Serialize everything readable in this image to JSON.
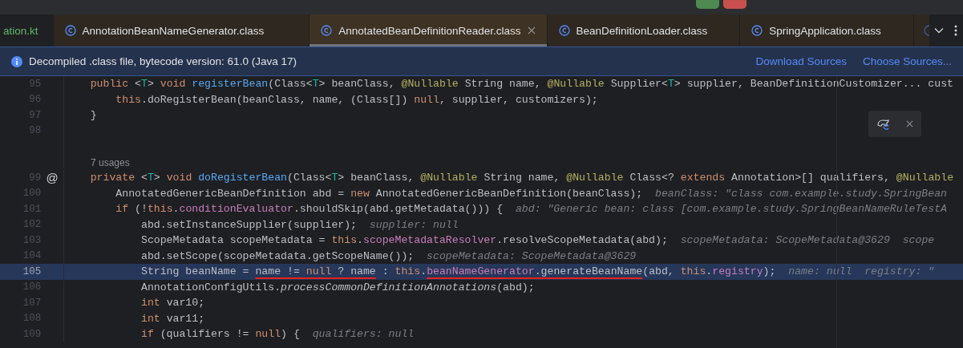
{
  "tabs": [
    {
      "kind": "kotlin",
      "label": "ation.kt",
      "selected": false
    },
    {
      "kind": "class",
      "label": "AnnotationBeanNameGenerator.class",
      "selected": false
    },
    {
      "kind": "class",
      "label": "AnnotatedBeanDefinitionReader.class",
      "selected": true
    },
    {
      "kind": "class",
      "label": "BeanDefinitionLoader.class",
      "selected": false
    },
    {
      "kind": "class",
      "label": "SpringApplication.class",
      "selected": false
    }
  ],
  "banner": {
    "message": "Decompiled .class file, bytecode version: 61.0 (Java 17)",
    "actions": [
      "Download Sources",
      "Choose Sources..."
    ]
  },
  "editor": {
    "lines": [
      {
        "kind": "code",
        "number": "95",
        "current": false,
        "tokens": [
          {
            "kind": "keyword",
            "text": "    public"
          },
          {
            "kind": "plain",
            "text": " <"
          },
          {
            "kind": "typeparam",
            "text": "T"
          },
          {
            "kind": "plain",
            "text": "> "
          },
          {
            "kind": "keyword",
            "text": "void"
          },
          {
            "kind": "method",
            "text": " registerBean"
          },
          {
            "kind": "plain",
            "text": "(Class<"
          },
          {
            "kind": "typeparam",
            "text": "T"
          },
          {
            "kind": "plain",
            "text": "> beanClass, "
          },
          {
            "kind": "annotation",
            "text": "@Nullable"
          },
          {
            "kind": "plain",
            "text": " String name, "
          },
          {
            "kind": "annotation",
            "text": "@Nullable"
          },
          {
            "kind": "plain",
            "text": " Supplier<"
          },
          {
            "kind": "typeparam",
            "text": "T"
          },
          {
            "kind": "plain",
            "text": "> supplier, BeanDefinitionCustomizer... cust"
          }
        ]
      },
      {
        "kind": "code",
        "number": "96",
        "current": false,
        "tokens": [
          {
            "kind": "keyword",
            "text": "        this"
          },
          {
            "kind": "plain",
            "text": ".doRegisterBean(beanClass, name, (Class[]) "
          },
          {
            "kind": "keyword",
            "text": "null"
          },
          {
            "kind": "plain",
            "text": ", supplier, customizers);"
          }
        ]
      },
      {
        "kind": "code",
        "number": "97",
        "current": false,
        "tokens": [
          {
            "kind": "plain",
            "text": "    }"
          }
        ]
      },
      {
        "kind": "code",
        "number": "98",
        "current": false
      },
      {
        "kind": "usages",
        "text": "7 usages"
      },
      {
        "kind": "code",
        "number": "99",
        "current": false,
        "gutter_mark": "@",
        "tokens": [
          {
            "kind": "keyword",
            "text": "    private"
          },
          {
            "kind": "plain",
            "text": " <"
          },
          {
            "kind": "typeparam",
            "text": "T"
          },
          {
            "kind": "plain",
            "text": "> "
          },
          {
            "kind": "keyword",
            "text": "void"
          },
          {
            "kind": "method",
            "text": " doRegisterBean"
          },
          {
            "kind": "plain",
            "text": "(Class<"
          },
          {
            "kind": "typeparam",
            "text": "T"
          },
          {
            "kind": "plain",
            "text": "> beanClass, "
          },
          {
            "kind": "annotation",
            "text": "@Nullable"
          },
          {
            "kind": "plain",
            "text": " String name, "
          },
          {
            "kind": "annotation",
            "text": "@Nullable"
          },
          {
            "kind": "plain",
            "text": " Class<? "
          },
          {
            "kind": "keyword",
            "text": "extends"
          },
          {
            "kind": "plain",
            "text": " Annotation>[] qualifiers, "
          },
          {
            "kind": "annotation",
            "text": "@Nullable"
          }
        ]
      },
      {
        "kind": "code",
        "number": "100",
        "current": false,
        "tokens": [
          {
            "kind": "plain",
            "text": "        AnnotatedGenericBeanDefinition abd = "
          },
          {
            "kind": "keyword",
            "text": "new"
          },
          {
            "kind": "plain",
            "text": " AnnotatedGenericBeanDefinition(beanClass);"
          }
        ],
        "hints": [
          "beanClass: \"class com.example.study.SpringBean"
        ]
      },
      {
        "kind": "code",
        "number": "101",
        "current": false,
        "tokens": [
          {
            "kind": "keyword",
            "text": "        if"
          },
          {
            "kind": "plain",
            "text": " (!"
          },
          {
            "kind": "keyword",
            "text": "this"
          },
          {
            "kind": "plain",
            "text": "."
          },
          {
            "kind": "field",
            "text": "conditionEvaluator"
          },
          {
            "kind": "plain",
            "text": ".shouldSkip(abd.getMetadata())) {"
          }
        ],
        "hints": [
          "abd: \"Generic bean: class [com.example.study.SpringBeanNameRuleTestA"
        ]
      },
      {
        "kind": "code",
        "number": "102",
        "current": false,
        "tokens": [
          {
            "kind": "plain",
            "text": "            abd.setInstanceSupplier(supplier);"
          }
        ],
        "hints": [
          "supplier: null"
        ]
      },
      {
        "kind": "code",
        "number": "103",
        "current": false,
        "tokens": [
          {
            "kind": "plain",
            "text": "            ScopeMetadata scopeMetadata = "
          },
          {
            "kind": "keyword",
            "text": "this"
          },
          {
            "kind": "plain",
            "text": "."
          },
          {
            "kind": "field",
            "text": "scopeMetadataResolver"
          },
          {
            "kind": "plain",
            "text": ".resolveScopeMetadata(abd);"
          }
        ],
        "hints": [
          "scopeMetadata: ScopeMetadata@3629",
          "scope"
        ]
      },
      {
        "kind": "code",
        "number": "104",
        "current": false,
        "tokens": [
          {
            "kind": "plain",
            "text": "            abd.setScope(scopeMetadata.getScopeName());"
          }
        ],
        "hints": [
          "scopeMetadata: ScopeMetadata@3629"
        ]
      },
      {
        "kind": "code",
        "number": "105",
        "current": true,
        "tokens": [
          {
            "kind": "plain",
            "text": "            String beanName = ",
            "underlined": false
          },
          {
            "kind": "plain",
            "text": "name != ",
            "underlined": true
          },
          {
            "kind": "keyword",
            "text": "null",
            "underlined": true
          },
          {
            "kind": "plain",
            "text": " ? name",
            "underlined": true
          },
          {
            "kind": "plain",
            "text": " : ",
            "underlined": false
          },
          {
            "kind": "keyword",
            "text": "this",
            "underlined": false
          },
          {
            "kind": "plain",
            "text": ".",
            "underlined": false
          },
          {
            "kind": "field",
            "text": "beanNameGenerator",
            "underlined": true
          },
          {
            "kind": "plain",
            "text": ".generateBeanName",
            "underlined": true
          },
          {
            "kind": "plain",
            "text": "(abd, ",
            "underlined": false
          },
          {
            "kind": "keyword",
            "text": "this",
            "underlined": false
          },
          {
            "kind": "plain",
            "text": ".",
            "underlined": false
          },
          {
            "kind": "field",
            "text": "registry",
            "underlined": false
          },
          {
            "kind": "plain",
            "text": ");",
            "underlined": false
          }
        ],
        "hints": [
          "name: null",
          "registry: \""
        ]
      },
      {
        "kind": "code",
        "number": "106",
        "current": false,
        "tokens": [
          {
            "kind": "plain",
            "text": "            AnnotationConfigUtils."
          },
          {
            "kind": "static",
            "text": "processCommonDefinitionAnnotations"
          },
          {
            "kind": "plain",
            "text": "(abd);"
          }
        ]
      },
      {
        "kind": "code",
        "number": "107",
        "current": false,
        "tokens": [
          {
            "kind": "keyword",
            "text": "            int"
          },
          {
            "kind": "plain",
            "text": " var10;"
          }
        ]
      },
      {
        "kind": "code",
        "number": "108",
        "current": false,
        "tokens": [
          {
            "kind": "keyword",
            "text": "            int"
          },
          {
            "kind": "plain",
            "text": " var11;"
          }
        ]
      },
      {
        "kind": "code",
        "number": "109",
        "current": false,
        "tokens": [
          {
            "kind": "keyword",
            "text": "            if"
          },
          {
            "kind": "plain",
            "text": " (qualifiers != "
          },
          {
            "kind": "keyword",
            "text": "null"
          },
          {
            "kind": "plain",
            "text": ") {"
          }
        ],
        "hints": [
          "qualifiers: null"
        ]
      }
    ]
  }
}
